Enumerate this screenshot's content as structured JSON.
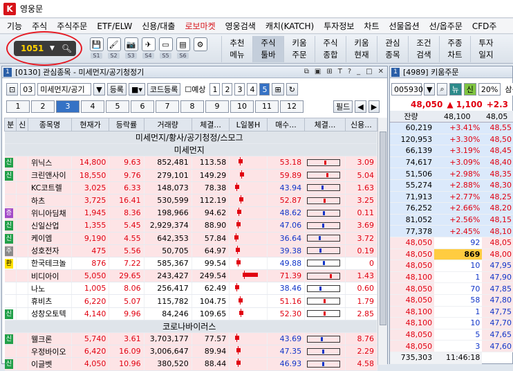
{
  "app": {
    "title": "영웅문"
  },
  "menu": [
    "기능",
    "주식",
    "주식주문",
    "ETF/ELW",
    "신용/대출",
    "로보마켓",
    "영웅검색",
    "캐치(KATCH)",
    "투자정보",
    "차트",
    "선물옵션",
    "선/옵주문",
    "CFD주"
  ],
  "toolbar": {
    "code": "1051",
    "icons": [
      {
        "name": "save-icon",
        "lb": "S1"
      },
      {
        "name": "brush-icon",
        "lb": "S2"
      },
      {
        "name": "camera-icon",
        "lb": "S3"
      },
      {
        "name": "plane-icon",
        "lb": "S4"
      },
      {
        "name": "monitor-icon",
        "lb": "S5"
      },
      {
        "name": "note-icon",
        "lb": "S6"
      },
      {
        "name": "gear-icon",
        "lb": ""
      }
    ],
    "buttons": [
      [
        "추천",
        "메뉴"
      ],
      [
        "주식",
        "툴바"
      ],
      [
        "키움",
        "주문"
      ],
      [
        "주식",
        "종합"
      ],
      [
        "키움",
        "현재"
      ],
      [
        "관심",
        "종목"
      ],
      [
        "조건",
        "검색"
      ],
      [
        "주종",
        "차트"
      ],
      [
        "투자",
        "일지"
      ]
    ]
  },
  "left": {
    "title": "[0130] 관심종목 - 미세먼지/공기청정기",
    "groupno": "03",
    "groupname": "미세먼지/공기",
    "reg": "등록",
    "codereg": "코드등록",
    "yesang": "예상",
    "pages": [
      "1",
      "2",
      "3",
      "4",
      "5"
    ],
    "active_page": "5",
    "tabs": [
      "1",
      "2",
      "3",
      "4",
      "5",
      "6",
      "7",
      "8",
      "9",
      "10",
      "11",
      "12"
    ],
    "active_tab": "3",
    "filter": "필드",
    "headers": [
      "분",
      "신",
      "종목명",
      "현재가",
      "등락률",
      "거래량",
      "체결...",
      "L일봉H",
      "매수...",
      "체결...",
      "신용..."
    ],
    "group1": "미세먼지/황사/공기청정/스모그",
    "sub1": "미세먼지",
    "sub2": "코로나바이러스",
    "rows1": [
      {
        "tag": "신",
        "tc": "g",
        "name": "위닉스",
        "price": "14,800",
        "rate": "9.63",
        "vol": "852,481",
        "ch": "113.58",
        "buy": "53.18",
        "cr": "3.09",
        "pos": 0.45,
        "pink": true
      },
      {
        "tag": "신",
        "tc": "g",
        "name": "크린앤사이",
        "price": "18,550",
        "rate": "9.76",
        "vol": "279,101",
        "ch": "149.29",
        "buy": "59.89",
        "cr": "5.04",
        "pos": 0.55,
        "pink": true
      },
      {
        "tag": "",
        "tc": "",
        "name": "KC코트렐",
        "price": "3,025",
        "rate": "6.33",
        "vol": "148,073",
        "ch": "78.38",
        "buy": "43.94",
        "cr": "1.63",
        "pos": 0.2,
        "pink": true
      },
      {
        "tag": "",
        "tc": "",
        "name": "하츠",
        "price": "3,725",
        "rate": "16.41",
        "vol": "530,599",
        "ch": "112.19",
        "buy": "52.87",
        "cr": "3.25",
        "pos": 0.5,
        "pink": true
      },
      {
        "tag": "증",
        "tc": "p",
        "name": "위니아딤채",
        "price": "1,945",
        "rate": "8.36",
        "vol": "198,966",
        "ch": "94.62",
        "buy": "48.62",
        "cr": "0.11",
        "pos": 0.35,
        "pink": true
      },
      {
        "tag": "신",
        "tc": "g",
        "name": "신일산업",
        "price": "1,355",
        "rate": "5.45",
        "vol": "2,929,374",
        "ch": "88.90",
        "buy": "47.06",
        "cr": "3.69",
        "pos": 0.3,
        "pink": true
      },
      {
        "tag": "신",
        "tc": "g",
        "name": "케이엠",
        "price": "9,190",
        "rate": "4.55",
        "vol": "642,353",
        "ch": "57.84",
        "buy": "36.64",
        "cr": "3.72",
        "pos": 0.15,
        "pink": true
      },
      {
        "tag": "주",
        "tc": "gy",
        "name": "성호전자",
        "price": "475",
        "rate": "5.56",
        "vol": "50,705",
        "ch": "64.97",
        "buy": "39.38",
        "cr": "0.19",
        "pos": 0.25,
        "pink": true
      },
      {
        "tag": "환",
        "tc": "y",
        "name": "한국테크놀",
        "price": "876",
        "rate": "7.22",
        "vol": "585,367",
        "ch": "99.54",
        "buy": "49.88",
        "cr": "0",
        "pos": 0.3,
        "pink": false
      },
      {
        "tag": "",
        "tc": "",
        "name": "비디아이",
        "price": "5,050",
        "rate": "29.65",
        "vol": "243,427",
        "ch": "249.54",
        "buy": "71.39",
        "cr": "1.43",
        "pos": 0.75,
        "pink": true
      },
      {
        "tag": "",
        "tc": "",
        "name": "나노",
        "price": "1,005",
        "rate": "8.06",
        "vol": "256,417",
        "ch": "62.49",
        "buy": "38.46",
        "cr": "0.60",
        "pos": 0.2,
        "pink": false
      },
      {
        "tag": "",
        "tc": "",
        "name": "휴비츠",
        "price": "6,220",
        "rate": "5.07",
        "vol": "115,782",
        "ch": "104.75",
        "buy": "51.16",
        "cr": "1.79",
        "pos": 0.45,
        "pink": false
      },
      {
        "tag": "신",
        "tc": "g",
        "name": "성창오토텍",
        "price": "4,140",
        "rate": "9.96",
        "vol": "84,246",
        "ch": "109.65",
        "buy": "52.30",
        "cr": "2.85",
        "pos": 0.5,
        "pink": false
      }
    ],
    "rows2": [
      {
        "tag": "신",
        "tc": "g",
        "name": "웰크론",
        "price": "5,740",
        "rate": "3.61",
        "vol": "3,703,177",
        "ch": "77.57",
        "buy": "43.69",
        "cr": "8.76",
        "pos": 0.2,
        "pink": true
      },
      {
        "tag": "",
        "tc": "",
        "name": "우정바이오",
        "price": "6,420",
        "rate": "16.09",
        "vol": "3,006,647",
        "ch": "89.94",
        "buy": "47.35",
        "cr": "2.29",
        "pos": 0.3,
        "pink": true
      },
      {
        "tag": "신",
        "tc": "g",
        "name": "이글벳",
        "price": "4,050",
        "rate": "10.96",
        "vol": "380,520",
        "ch": "88.44",
        "buy": "46.93",
        "cr": "4.58",
        "pos": 0.3,
        "pink": true
      }
    ]
  },
  "right": {
    "title": "[4989] 키움주문",
    "code": "005930",
    "sel": "뉴",
    "credit": "신",
    "pct": "20%",
    "extra": "삼성",
    "price": "48,050",
    "chg": "▲ 1,100",
    "chgpct": "+2.3",
    "hdr1": "잔량",
    "hdr2": "48,100",
    "hdr3": "48,05",
    "asks": [
      [
        "60,219",
        "+3.41%",
        "48,55"
      ],
      [
        "120,953",
        "+3.30%",
        "48,50"
      ],
      [
        "66,139",
        "+3.19%",
        "48,45"
      ],
      [
        "74,617",
        "+3.09%",
        "48,40"
      ],
      [
        "51,506",
        "+2.98%",
        "48,35"
      ],
      [
        "55,274",
        "+2.88%",
        "48,30"
      ],
      [
        "71,913",
        "+2.77%",
        "48,25"
      ],
      [
        "76,252",
        "+2.66%",
        "48,20"
      ],
      [
        "81,052",
        "+2.56%",
        "48,15"
      ],
      [
        "77,378",
        "+2.45%",
        "48,10"
      ]
    ],
    "bids": [
      [
        "48,050",
        "92",
        "48,05"
      ],
      [
        "48,050",
        "869",
        "48,00"
      ],
      [
        "48,050",
        "10",
        "47,95"
      ],
      [
        "48,100",
        "1",
        "47,90"
      ],
      [
        "48,050",
        "70",
        "47,85"
      ],
      [
        "48,050",
        "58",
        "47,80"
      ],
      [
        "48,100",
        "1",
        "47,75"
      ],
      [
        "48,100",
        "10",
        "47,70"
      ],
      [
        "48,050",
        "5",
        "47,65"
      ],
      [
        "48,050",
        "3",
        "47,60"
      ]
    ],
    "foot1": "735,303",
    "foot2": "11:46:18"
  },
  "colors": {
    "up": "#e10010",
    "down": "#1035c8"
  }
}
